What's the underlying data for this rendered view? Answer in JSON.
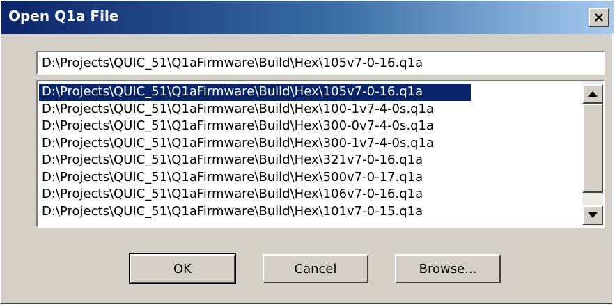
{
  "window": {
    "title": "Open Q1a File"
  },
  "path_input": {
    "value": "D:\\Projects\\QUIC_51\\Q1aFirmware\\Build\\Hex\\105v7-0-16.q1a"
  },
  "file_list": {
    "selected_index": 0,
    "items": [
      "D:\\Projects\\QUIC_51\\Q1aFirmware\\Build\\Hex\\105v7-0-16.q1a",
      "D:\\Projects\\QUIC_51\\Q1aFirmware\\Build\\Hex\\100-1v7-4-0s.q1a",
      "D:\\Projects\\QUIC_51\\Q1aFirmware\\Build\\Hex\\300-0v7-4-0s.q1a",
      "D:\\Projects\\QUIC_51\\Q1aFirmware\\Build\\Hex\\300-1v7-4-0s.q1a",
      "D:\\Projects\\QUIC_51\\Q1aFirmware\\Build\\Hex\\321v7-0-16.q1a",
      "D:\\Projects\\QUIC_51\\Q1aFirmware\\Build\\Hex\\500v7-0-17.q1a",
      "D:\\Projects\\QUIC_51\\Q1aFirmware\\Build\\Hex\\106v7-0-16.q1a",
      "D:\\Projects\\QUIC_51\\Q1aFirmware\\Build\\Hex\\101v7-0-15.q1a"
    ]
  },
  "buttons": {
    "ok": "OK",
    "cancel": "Cancel",
    "browse": "Browse..."
  },
  "icons": {
    "close": "close-icon",
    "scroll_up": "arrow-up-icon",
    "scroll_down": "arrow-down-icon"
  },
  "colors": {
    "title_start": "#0a246a",
    "title_end": "#a6caf0",
    "selection": "#0a246a",
    "face": "#d4d0c8"
  }
}
